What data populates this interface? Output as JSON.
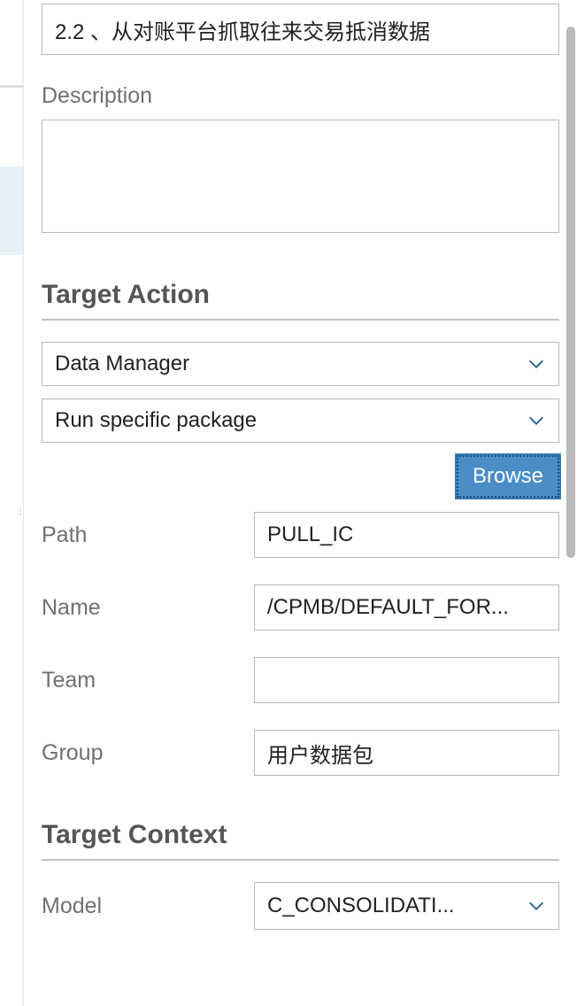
{
  "title_value": "2.2 、从对账平台抓取往来交易抵消数据",
  "description_label": "Description",
  "description_value": "",
  "target_action_heading": "Target Action",
  "action_type_value": "Data Manager",
  "action_sub_value": "Run specific package",
  "browse_label": "Browse",
  "fields": {
    "path_label": "Path",
    "path_value": "PULL_IC",
    "name_label": "Name",
    "name_value": "/CPMB/DEFAULT_FOR...",
    "team_label": "Team",
    "team_value": "",
    "group_label": "Group",
    "group_value": "用户数据包"
  },
  "target_context_heading": "Target Context",
  "model_label": "Model",
  "model_value": "C_CONSOLIDATI..."
}
